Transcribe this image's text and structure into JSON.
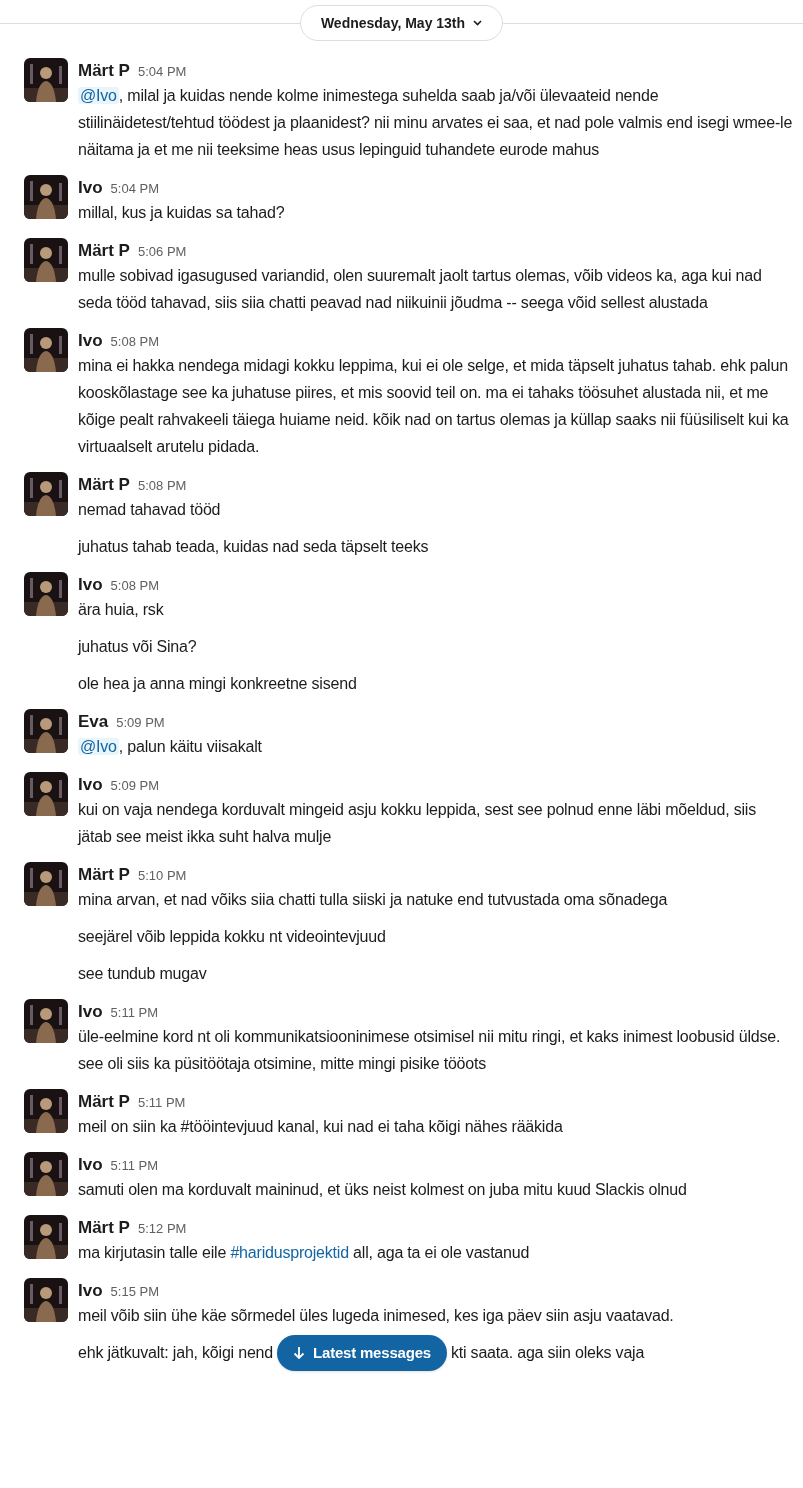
{
  "date_divider": {
    "label": "Wednesday, May 13th"
  },
  "messages": [
    {
      "author": "Märt P",
      "time": "5:04 PM",
      "paragraphs": [
        [
          {
            "kind": "mention",
            "text": "@Ivo"
          },
          {
            "kind": "text",
            "text": ", milal ja kuidas nende kolme inimestega suhelda saab ja/või ülevaateid nende stiilinäidetest/tehtud töödest ja plaanidest? nii minu arvates ei saa, et nad pole valmis end isegi wmee-le näitama ja et me nii teeksime heas usus lepinguid tuhandete eurode mahus"
          }
        ]
      ]
    },
    {
      "author": "Ivo",
      "time": "5:04 PM",
      "paragraphs": [
        [
          {
            "kind": "text",
            "text": "millal, kus ja kuidas sa tahad?"
          }
        ]
      ]
    },
    {
      "author": "Märt P",
      "time": "5:06 PM",
      "paragraphs": [
        [
          {
            "kind": "text",
            "text": "mulle sobivad igasugused variandid, olen suuremalt jaolt tartus olemas, võib videos ka, aga kui nad seda tööd tahavad, siis siia chatti peavad nad niikuinii jõudma -- seega võid sellest alustada"
          }
        ]
      ]
    },
    {
      "author": "Ivo",
      "time": "5:08 PM",
      "paragraphs": [
        [
          {
            "kind": "text",
            "text": "mina ei hakka nendega midagi kokku leppima, kui ei ole selge, et mida täpselt juhatus tahab. ehk palun kooskõlastage see ka juhatuse piires, et mis soovid teil on. ma ei tahaks töösuhet alustada nii, et me kõige pealt rahvakeeli täiega huiame neid. kõik nad on tartus olemas ja küllap saaks nii füüsiliselt kui ka virtuaalselt arutelu pidada."
          }
        ]
      ]
    },
    {
      "author": "Märt P",
      "time": "5:08 PM",
      "paragraphs": [
        [
          {
            "kind": "text",
            "text": "nemad tahavad tööd"
          }
        ],
        [
          {
            "kind": "text",
            "text": "juhatus tahab teada, kuidas nad seda täpselt teeks"
          }
        ]
      ]
    },
    {
      "author": "Ivo",
      "time": "5:08 PM",
      "paragraphs": [
        [
          {
            "kind": "text",
            "text": "ära huia, rsk"
          }
        ],
        [
          {
            "kind": "text",
            "text": "juhatus või Sina?"
          }
        ],
        [
          {
            "kind": "text",
            "text": "ole hea ja anna mingi konkreetne sisend"
          }
        ]
      ]
    },
    {
      "author": "Eva",
      "time": "5:09 PM",
      "paragraphs": [
        [
          {
            "kind": "mention",
            "text": "@Ivo"
          },
          {
            "kind": "text",
            "text": ", palun käitu viisakalt"
          }
        ]
      ]
    },
    {
      "author": "Ivo",
      "time": "5:09 PM",
      "paragraphs": [
        [
          {
            "kind": "text",
            "text": "kui on vaja nendega korduvalt mingeid asju kokku leppida, sest see polnud enne läbi mõeldud, siis jätab see meist ikka suht halva mulje"
          }
        ]
      ]
    },
    {
      "author": "Märt P",
      "time": "5:10 PM",
      "paragraphs": [
        [
          {
            "kind": "text",
            "text": "mina arvan, et nad võiks siia chatti tulla siiski ja natuke end tutvustada oma sõnadega"
          }
        ],
        [
          {
            "kind": "text",
            "text": "seejärel võib leppida kokku nt videointevjuud"
          }
        ],
        [
          {
            "kind": "text",
            "text": "see tundub mugav"
          }
        ]
      ]
    },
    {
      "author": "Ivo",
      "time": "5:11 PM",
      "paragraphs": [
        [
          {
            "kind": "text",
            "text": "üle-eelmine kord nt oli kommunikatsiooninimese otsimisel nii mitu ringi, et kaks inimest loobusid üldse.  see oli siis ka püsitöötaja otsimine, mitte mingi pisike tööots"
          }
        ]
      ]
    },
    {
      "author": "Märt P",
      "time": "5:11 PM",
      "paragraphs": [
        [
          {
            "kind": "text",
            "text": "meil on siin ka #tööintevjuud kanal, kui nad ei taha kõigi nähes rääkida"
          }
        ]
      ]
    },
    {
      "author": "Ivo",
      "time": "5:11 PM",
      "paragraphs": [
        [
          {
            "kind": "text",
            "text": "samuti olen ma korduvalt maininud, et üks neist kolmest on juba mitu kuud Slackis olnud"
          }
        ]
      ]
    },
    {
      "author": "Märt P",
      "time": "5:12 PM",
      "paragraphs": [
        [
          {
            "kind": "text",
            "text": "ma kirjutasin talle eile "
          },
          {
            "kind": "channel",
            "text": "#haridusprojektid"
          },
          {
            "kind": "text",
            "text": " all, aga ta ei ole vastanud"
          }
        ]
      ]
    },
    {
      "author": "Ivo",
      "time": "5:15 PM",
      "paragraphs": [
        [
          {
            "kind": "text",
            "text": "meil võib siin ühe käe sõrmedel üles lugeda inimesed, kes iga päev siin asju vaatavad."
          }
        ],
        [
          {
            "kind": "text",
            "text": "ehk jätkuvalt: jah, kõigi nend"
          },
          {
            "kind": "latest_button"
          },
          {
            "kind": "text",
            "text": "kti saata. aga siin oleks vaja"
          }
        ]
      ]
    }
  ],
  "latest_button": {
    "label": "Latest messages"
  }
}
